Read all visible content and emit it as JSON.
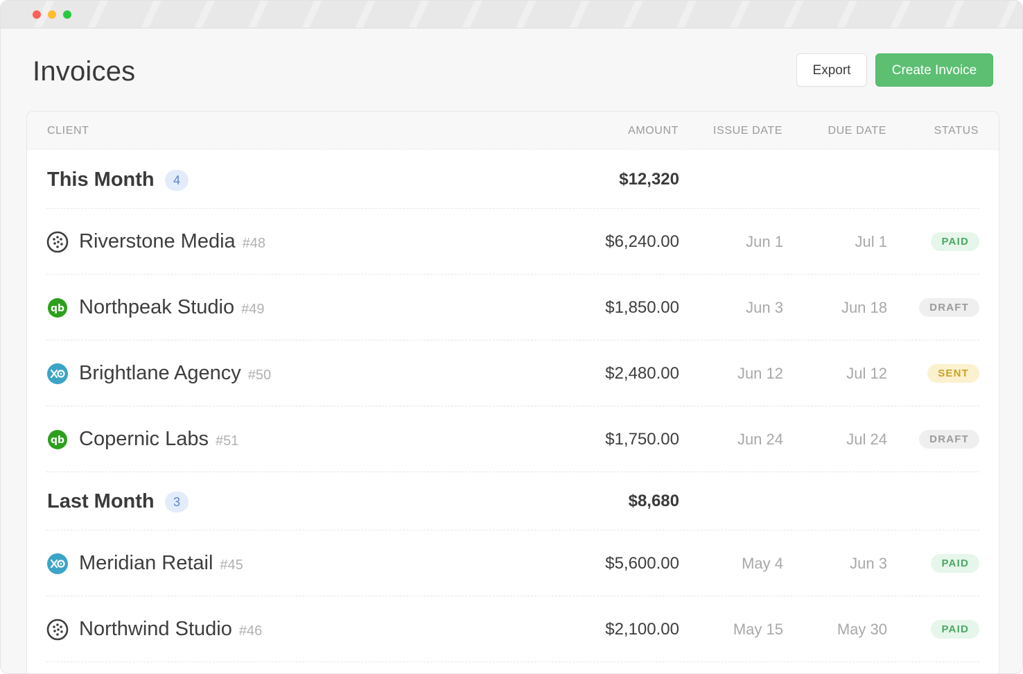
{
  "page": {
    "title": "Invoices"
  },
  "actions": {
    "export_label": "Export",
    "create_label": "Create Invoice"
  },
  "table": {
    "headers": {
      "client": "CLIENT",
      "amount": "AMOUNT",
      "issue_date": "ISSUE DATE",
      "due_date": "DUE DATE",
      "status": "STATUS"
    },
    "groups": [
      {
        "title": "This Month",
        "count": "4",
        "total": "$12,320",
        "rows": [
          {
            "integration": "wave-icon",
            "client": "Riverstone Media",
            "number": "#48",
            "amount": "$6,240.00",
            "issue": "Jun 1",
            "due": "Jul 1",
            "status": "PAID",
            "status_kind": "paid"
          },
          {
            "integration": "quickbooks-icon",
            "client": "Northpeak Studio",
            "number": "#49",
            "amount": "$1,850.00",
            "issue": "Jun 3",
            "due": "Jun 18",
            "status": "DRAFT",
            "status_kind": "draft"
          },
          {
            "integration": "xero-icon",
            "client": "Brightlane Agency",
            "number": "#50",
            "amount": "$2,480.00",
            "issue": "Jun 12",
            "due": "Jul 12",
            "status": "SENT",
            "status_kind": "sent"
          },
          {
            "integration": "quickbooks-icon",
            "client": "Copernic Labs",
            "number": "#51",
            "amount": "$1,750.00",
            "issue": "Jun 24",
            "due": "Jul 24",
            "status": "DRAFT",
            "status_kind": "draft"
          }
        ]
      },
      {
        "title": "Last Month",
        "count": "3",
        "total": "$8,680",
        "rows": [
          {
            "integration": "xero-icon",
            "client": "Meridian Retail",
            "number": "#45",
            "amount": "$5,600.00",
            "issue": "May 4",
            "due": "Jun 3",
            "status": "PAID",
            "status_kind": "paid"
          },
          {
            "integration": "wave-icon",
            "client": "Northwind Studio",
            "number": "#46",
            "amount": "$2,100.00",
            "issue": "May 15",
            "due": "May 30",
            "status": "PAID",
            "status_kind": "paid"
          }
        ]
      }
    ]
  },
  "colors": {
    "accent_green": "#5cbf72",
    "quickbooks": "#2ca01c",
    "xero": "#3ba4c7",
    "badge_blue": "#5b86d6"
  }
}
